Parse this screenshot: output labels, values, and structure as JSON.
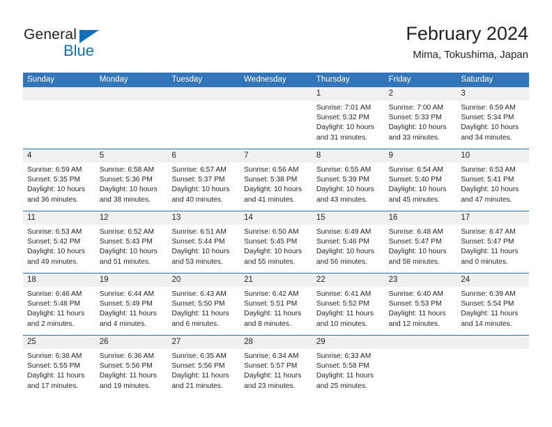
{
  "brand": {
    "name_part1": "General",
    "name_part2": "Blue",
    "logo_icon": "triangle-flag-icon",
    "accent_color": "#1170b8"
  },
  "header": {
    "title": "February 2024",
    "subtitle": "Mima, Tokushima, Japan"
  },
  "theme": {
    "header_blue": "#3275b8",
    "row_divider_blue": "#2b6ca8",
    "daynum_band_gray": "#f0f0f0",
    "text_color": "#231f20"
  },
  "calendar": {
    "weekdays": [
      "Sunday",
      "Monday",
      "Tuesday",
      "Wednesday",
      "Thursday",
      "Friday",
      "Saturday"
    ],
    "weeks": [
      {
        "days": [
          {
            "num": "",
            "empty": true,
            "sunrise": "",
            "sunset": "",
            "daylight_line1": "",
            "daylight_line2": ""
          },
          {
            "num": "",
            "empty": true,
            "sunrise": "",
            "sunset": "",
            "daylight_line1": "",
            "daylight_line2": ""
          },
          {
            "num": "",
            "empty": true,
            "sunrise": "",
            "sunset": "",
            "daylight_line1": "",
            "daylight_line2": ""
          },
          {
            "num": "",
            "empty": true,
            "sunrise": "",
            "sunset": "",
            "daylight_line1": "",
            "daylight_line2": ""
          },
          {
            "num": "1",
            "empty": false,
            "sunrise": "Sunrise: 7:01 AM",
            "sunset": "Sunset: 5:32 PM",
            "daylight_line1": "Daylight: 10 hours",
            "daylight_line2": "and 31 minutes."
          },
          {
            "num": "2",
            "empty": false,
            "sunrise": "Sunrise: 7:00 AM",
            "sunset": "Sunset: 5:33 PM",
            "daylight_line1": "Daylight: 10 hours",
            "daylight_line2": "and 33 minutes."
          },
          {
            "num": "3",
            "empty": false,
            "sunrise": "Sunrise: 6:59 AM",
            "sunset": "Sunset: 5:34 PM",
            "daylight_line1": "Daylight: 10 hours",
            "daylight_line2": "and 34 minutes."
          }
        ]
      },
      {
        "days": [
          {
            "num": "4",
            "empty": false,
            "sunrise": "Sunrise: 6:59 AM",
            "sunset": "Sunset: 5:35 PM",
            "daylight_line1": "Daylight: 10 hours",
            "daylight_line2": "and 36 minutes."
          },
          {
            "num": "5",
            "empty": false,
            "sunrise": "Sunrise: 6:58 AM",
            "sunset": "Sunset: 5:36 PM",
            "daylight_line1": "Daylight: 10 hours",
            "daylight_line2": "and 38 minutes."
          },
          {
            "num": "6",
            "empty": false,
            "sunrise": "Sunrise: 6:57 AM",
            "sunset": "Sunset: 5:37 PM",
            "daylight_line1": "Daylight: 10 hours",
            "daylight_line2": "and 40 minutes."
          },
          {
            "num": "7",
            "empty": false,
            "sunrise": "Sunrise: 6:56 AM",
            "sunset": "Sunset: 5:38 PM",
            "daylight_line1": "Daylight: 10 hours",
            "daylight_line2": "and 41 minutes."
          },
          {
            "num": "8",
            "empty": false,
            "sunrise": "Sunrise: 6:55 AM",
            "sunset": "Sunset: 5:39 PM",
            "daylight_line1": "Daylight: 10 hours",
            "daylight_line2": "and 43 minutes."
          },
          {
            "num": "9",
            "empty": false,
            "sunrise": "Sunrise: 6:54 AM",
            "sunset": "Sunset: 5:40 PM",
            "daylight_line1": "Daylight: 10 hours",
            "daylight_line2": "and 45 minutes."
          },
          {
            "num": "10",
            "empty": false,
            "sunrise": "Sunrise: 6:53 AM",
            "sunset": "Sunset: 5:41 PM",
            "daylight_line1": "Daylight: 10 hours",
            "daylight_line2": "and 47 minutes."
          }
        ]
      },
      {
        "days": [
          {
            "num": "11",
            "empty": false,
            "sunrise": "Sunrise: 6:53 AM",
            "sunset": "Sunset: 5:42 PM",
            "daylight_line1": "Daylight: 10 hours",
            "daylight_line2": "and 49 minutes."
          },
          {
            "num": "12",
            "empty": false,
            "sunrise": "Sunrise: 6:52 AM",
            "sunset": "Sunset: 5:43 PM",
            "daylight_line1": "Daylight: 10 hours",
            "daylight_line2": "and 51 minutes."
          },
          {
            "num": "13",
            "empty": false,
            "sunrise": "Sunrise: 6:51 AM",
            "sunset": "Sunset: 5:44 PM",
            "daylight_line1": "Daylight: 10 hours",
            "daylight_line2": "and 53 minutes."
          },
          {
            "num": "14",
            "empty": false,
            "sunrise": "Sunrise: 6:50 AM",
            "sunset": "Sunset: 5:45 PM",
            "daylight_line1": "Daylight: 10 hours",
            "daylight_line2": "and 55 minutes."
          },
          {
            "num": "15",
            "empty": false,
            "sunrise": "Sunrise: 6:49 AM",
            "sunset": "Sunset: 5:46 PM",
            "daylight_line1": "Daylight: 10 hours",
            "daylight_line2": "and 56 minutes."
          },
          {
            "num": "16",
            "empty": false,
            "sunrise": "Sunrise: 6:48 AM",
            "sunset": "Sunset: 5:47 PM",
            "daylight_line1": "Daylight: 10 hours",
            "daylight_line2": "and 58 minutes."
          },
          {
            "num": "17",
            "empty": false,
            "sunrise": "Sunrise: 6:47 AM",
            "sunset": "Sunset: 5:47 PM",
            "daylight_line1": "Daylight: 11 hours",
            "daylight_line2": "and 0 minutes."
          }
        ]
      },
      {
        "days": [
          {
            "num": "18",
            "empty": false,
            "sunrise": "Sunrise: 6:46 AM",
            "sunset": "Sunset: 5:48 PM",
            "daylight_line1": "Daylight: 11 hours",
            "daylight_line2": "and 2 minutes."
          },
          {
            "num": "19",
            "empty": false,
            "sunrise": "Sunrise: 6:44 AM",
            "sunset": "Sunset: 5:49 PM",
            "daylight_line1": "Daylight: 11 hours",
            "daylight_line2": "and 4 minutes."
          },
          {
            "num": "20",
            "empty": false,
            "sunrise": "Sunrise: 6:43 AM",
            "sunset": "Sunset: 5:50 PM",
            "daylight_line1": "Daylight: 11 hours",
            "daylight_line2": "and 6 minutes."
          },
          {
            "num": "21",
            "empty": false,
            "sunrise": "Sunrise: 6:42 AM",
            "sunset": "Sunset: 5:51 PM",
            "daylight_line1": "Daylight: 11 hours",
            "daylight_line2": "and 8 minutes."
          },
          {
            "num": "22",
            "empty": false,
            "sunrise": "Sunrise: 6:41 AM",
            "sunset": "Sunset: 5:52 PM",
            "daylight_line1": "Daylight: 11 hours",
            "daylight_line2": "and 10 minutes."
          },
          {
            "num": "23",
            "empty": false,
            "sunrise": "Sunrise: 6:40 AM",
            "sunset": "Sunset: 5:53 PM",
            "daylight_line1": "Daylight: 11 hours",
            "daylight_line2": "and 12 minutes."
          },
          {
            "num": "24",
            "empty": false,
            "sunrise": "Sunrise: 6:39 AM",
            "sunset": "Sunset: 5:54 PM",
            "daylight_line1": "Daylight: 11 hours",
            "daylight_line2": "and 14 minutes."
          }
        ]
      },
      {
        "days": [
          {
            "num": "25",
            "empty": false,
            "sunrise": "Sunrise: 6:38 AM",
            "sunset": "Sunset: 5:55 PM",
            "daylight_line1": "Daylight: 11 hours",
            "daylight_line2": "and 17 minutes."
          },
          {
            "num": "26",
            "empty": false,
            "sunrise": "Sunrise: 6:36 AM",
            "sunset": "Sunset: 5:56 PM",
            "daylight_line1": "Daylight: 11 hours",
            "daylight_line2": "and 19 minutes."
          },
          {
            "num": "27",
            "empty": false,
            "sunrise": "Sunrise: 6:35 AM",
            "sunset": "Sunset: 5:56 PM",
            "daylight_line1": "Daylight: 11 hours",
            "daylight_line2": "and 21 minutes."
          },
          {
            "num": "28",
            "empty": false,
            "sunrise": "Sunrise: 6:34 AM",
            "sunset": "Sunset: 5:57 PM",
            "daylight_line1": "Daylight: 11 hours",
            "daylight_line2": "and 23 minutes."
          },
          {
            "num": "29",
            "empty": false,
            "sunrise": "Sunrise: 6:33 AM",
            "sunset": "Sunset: 5:58 PM",
            "daylight_line1": "Daylight: 11 hours",
            "daylight_line2": "and 25 minutes."
          },
          {
            "num": "",
            "empty": true,
            "sunrise": "",
            "sunset": "",
            "daylight_line1": "",
            "daylight_line2": ""
          },
          {
            "num": "",
            "empty": true,
            "sunrise": "",
            "sunset": "",
            "daylight_line1": "",
            "daylight_line2": ""
          }
        ]
      }
    ]
  }
}
